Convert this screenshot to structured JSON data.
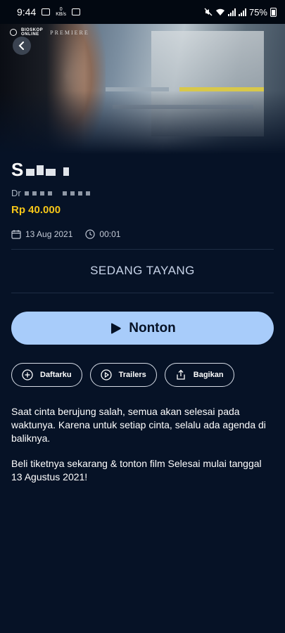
{
  "status_bar": {
    "time": "9:44",
    "net_speed_value": "0",
    "net_speed_unit": "KB/s",
    "battery": "75%"
  },
  "brand": {
    "line1": "BIOSKOP",
    "line2": "ONLINE",
    "premiere": "PREMIERE"
  },
  "movie": {
    "title_visible": "S",
    "director_prefix": "Dr",
    "price": "Rp 40.000",
    "date": "13 Aug 2021",
    "duration": "00:01",
    "status": "SEDANG TAYANG",
    "watch_label": "Nonton"
  },
  "actions": [
    {
      "label": "Daftarku",
      "icon": "plus-circle-icon"
    },
    {
      "label": "Trailers",
      "icon": "play-circle-icon"
    },
    {
      "label": "Bagikan",
      "icon": "share-icon"
    }
  ],
  "description": {
    "p1": "Saat cinta berujung salah, semua akan selesai pada waktunya. Karena untuk setiap cinta, selalu ada agenda di baliknya.",
    "p2": "Beli tiketnya sekarang & tonton film Selesai mulai tanggal 13 Agustus 2021!"
  },
  "colors": {
    "background": "#061226",
    "price": "#f5c518",
    "watch_button": "#a8ccfa"
  }
}
